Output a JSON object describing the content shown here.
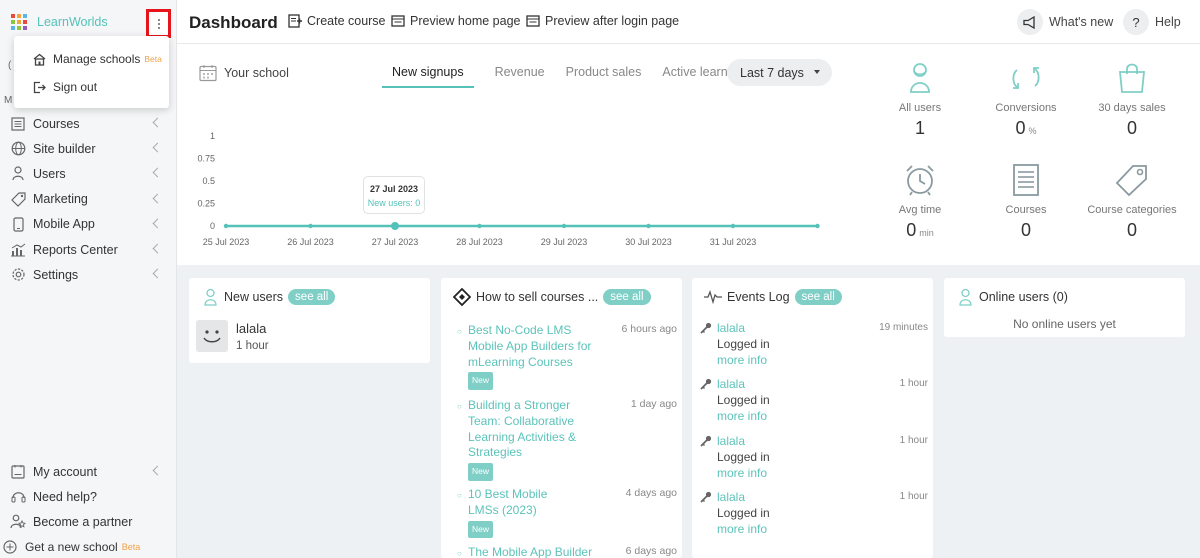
{
  "brand": {
    "name": "LearnWorlds",
    "logo_colors": [
      "#e8493f",
      "#f4a53a",
      "#5bb5e8",
      "#8dc63f",
      "#f4a53a",
      "#e8493f",
      "#5bb5e8",
      "#8dc63f",
      "#9b59b6"
    ]
  },
  "popup_menu": {
    "items": [
      {
        "label": "Manage schools",
        "badge": "Beta",
        "icon": "school-icon"
      },
      {
        "label": "Sign out",
        "icon": "sign-out-icon"
      }
    ]
  },
  "sidebar": {
    "items": [
      {
        "label": "Courses",
        "icon": "courses-icon"
      },
      {
        "label": "Site builder",
        "icon": "globe-icon"
      },
      {
        "label": "Users",
        "icon": "user-icon"
      },
      {
        "label": "Marketing",
        "icon": "tag-icon"
      },
      {
        "label": "Mobile App",
        "icon": "mobile-icon"
      },
      {
        "label": "Reports Center",
        "icon": "chart-icon"
      },
      {
        "label": "Settings",
        "icon": "gear-icon"
      }
    ],
    "bottom_items": [
      {
        "label": "My account",
        "icon": "account-icon",
        "has_chevron": true
      },
      {
        "label": "Need help?",
        "icon": "headset-icon"
      },
      {
        "label": "Become a partner",
        "icon": "partner-icon"
      },
      {
        "label": "Get a new school",
        "badge": "Beta",
        "icon": "plus-circle-icon"
      }
    ],
    "clipped_letter_1": "(",
    "clipped_letter_2": "M"
  },
  "header": {
    "title": "Dashboard",
    "actions": [
      "Create course",
      "Preview home page",
      "Preview after login page"
    ],
    "whats_new": "What's new",
    "help": "Help",
    "help_glyph": "?"
  },
  "stats": {
    "school_label": "Your school",
    "tabs": [
      "New signups",
      "Revenue",
      "Product sales",
      "Active learners"
    ],
    "active_tab": "New signups",
    "range": "Last 7 days",
    "tooltip": {
      "date": "27 Jul 2023",
      "text": "New users: 0"
    },
    "kpis": [
      {
        "label": "All users",
        "value": "1",
        "unit": "",
        "icon": "user-outline-icon"
      },
      {
        "label": "Conversions",
        "value": "0",
        "unit": "%",
        "icon": "conversion-icon"
      },
      {
        "label": "30 days sales",
        "value": "0",
        "unit": "",
        "icon": "shopping-bag-icon"
      },
      {
        "label": "Avg time",
        "value": "0",
        "unit": "min",
        "icon": "alarm-clock-icon"
      },
      {
        "label": "Courses",
        "value": "0",
        "unit": "",
        "icon": "document-icon"
      },
      {
        "label": "Course categories",
        "value": "0",
        "unit": "",
        "icon": "tag-outline-icon"
      }
    ],
    "accent": "#54c2b8"
  },
  "chart_data": {
    "type": "line",
    "x": [
      "25 Jul 2023",
      "26 Jul 2023",
      "27 Jul 2023",
      "28 Jul 2023",
      "29 Jul 2023",
      "30 Jul 2023",
      "31 Jul 2023",
      ""
    ],
    "series": [
      {
        "name": "New users",
        "values": [
          0,
          0,
          0,
          0,
          0,
          0,
          0,
          0
        ]
      }
    ],
    "y_ticks": [
      "1",
      "0.75",
      "0.5",
      "0.25",
      "0"
    ],
    "ylim": [
      0,
      1
    ]
  },
  "cards": {
    "new_users": {
      "title": "New users",
      "see_all": "see all",
      "users": [
        {
          "name": "lalala",
          "time": "1 hour"
        }
      ]
    },
    "how_to_sell": {
      "title": "How to sell courses ...",
      "see_all": "see all",
      "articles": [
        {
          "title": "Best No-Code LMS Mobile App Builders for mLearning Courses",
          "time": "6 hours ago",
          "badge": "New"
        },
        {
          "title": "Building a Stronger Team: Collaborative Learning Activities & Strategies",
          "time": "1 day ago",
          "badge": "New"
        },
        {
          "title": "10 Best Mobile LMSs (2023)",
          "time": "4 days ago",
          "badge": "New"
        },
        {
          "title": "The Mobile App Builder",
          "time": "6 days ago",
          "badge": ""
        }
      ]
    },
    "events_log": {
      "title": "Events Log",
      "see_all": "see all",
      "events": [
        {
          "user": "lalala",
          "action": "Logged in",
          "more": "more info",
          "time": "19 minutes"
        },
        {
          "user": "lalala",
          "action": "Logged in",
          "more": "more info",
          "time": "1 hour"
        },
        {
          "user": "lalala",
          "action": "Logged in",
          "more": "more info",
          "time": "1 hour"
        },
        {
          "user": "lalala",
          "action": "Logged in",
          "more": "more info",
          "time": "1 hour"
        }
      ]
    },
    "online_users": {
      "title": "Online users (0)",
      "empty": "No online users yet"
    }
  }
}
